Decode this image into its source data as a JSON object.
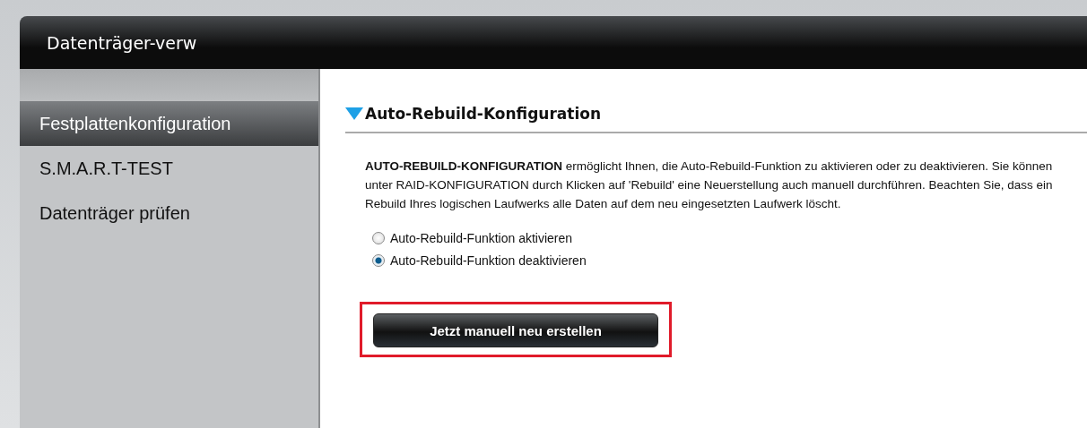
{
  "window": {
    "title": "Datenträger-verw"
  },
  "sidebar": {
    "items": [
      {
        "label": "Festplattenkonfiguration",
        "selected": true
      },
      {
        "label": "S.M.A.R.T-TEST",
        "selected": false
      },
      {
        "label": "Datenträger prüfen",
        "selected": false
      }
    ]
  },
  "section": {
    "title": "Auto-Rebuild-Konfiguration",
    "expanded": true,
    "description": "**AUTO-REBUILD-KONFIGURATION** ermöglicht Ihnen, die Auto-Rebuild-Funktion zu aktivieren oder zu deaktivieren. Sie können unter RAID-KONFIGURATION durch Klicken auf 'Rebuild' eine Neuerstellung auch manuell durchführen. Beachten Sie, dass ein Rebuild Ihres logischen Laufwerks alle Daten auf dem neu eingesetzten Laufwerk löscht.",
    "options": [
      {
        "label": "Auto-Rebuild-Funktion aktivieren",
        "selected": false
      },
      {
        "label": "Auto-Rebuild-Funktion deaktivieren",
        "selected": true
      }
    ],
    "button": {
      "label": "Jetzt manuell neu erstellen",
      "highlighted": true
    }
  }
}
